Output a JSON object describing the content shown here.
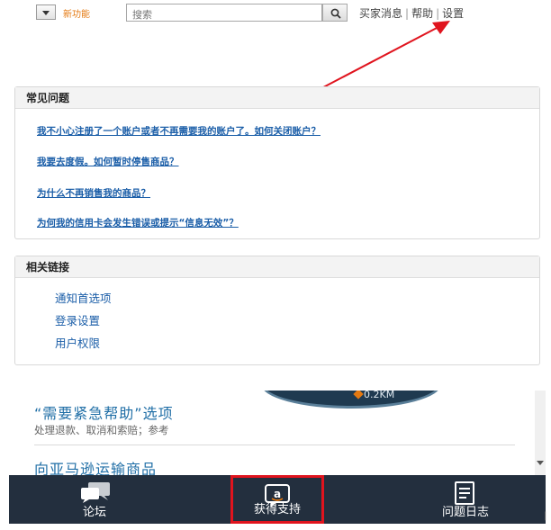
{
  "toolbar": {
    "new_feature_label": "新功能",
    "search_placeholder": "搜索",
    "links": [
      "买家消息",
      "帮助",
      "设置"
    ],
    "separator": "|"
  },
  "faq": {
    "title": "常见问题",
    "items": [
      "我不小心注册了一个账户或者不再需要我的账户了。如何关闭账户？",
      "我要去度假。如何暂时停售商品？",
      "为什么不再销售我的商品？",
      "为何我的信用卡会发生错误或提示“信息无效”？"
    ]
  },
  "related": {
    "title": "相关链接",
    "items": [
      "通知首选项",
      "登录设置",
      "用户权限"
    ]
  },
  "mobile": {
    "promo_text": "0.2KM",
    "urgent_title": "“需要紧急帮助”选项",
    "urgent_sub": "处理退款、取消和索赔；参考",
    "ship_link": "向亚马逊运输商品",
    "tabs": [
      {
        "label": "论坛",
        "icon": "chat-bubbles-icon"
      },
      {
        "label": "获得支持",
        "icon": "amazon-support-icon"
      },
      {
        "label": "问题日志",
        "icon": "document-list-icon"
      }
    ]
  },
  "tail_mark": "|",
  "colors": {
    "link_blue": "#1b5ea8",
    "tab_bar": "#232f3e",
    "highlight_red": "#e0141e",
    "annotation_arrow": "#e0141e",
    "amazon_orange": "#e47911"
  }
}
